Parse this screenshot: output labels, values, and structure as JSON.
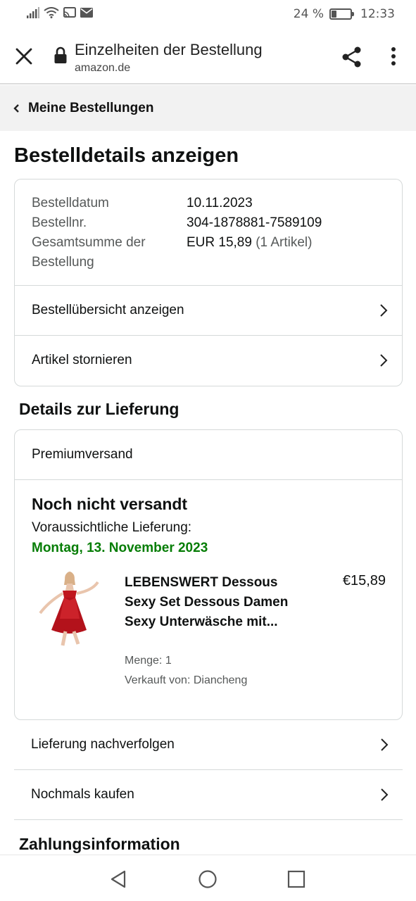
{
  "status_bar": {
    "battery_percent": "24 %",
    "battery_level": 0.24,
    "time": "12:33"
  },
  "browser": {
    "title": "Einzelheiten der Bestellung",
    "domain": "amazon.de",
    "icons": [
      "close-icon",
      "lock-icon",
      "share-icon",
      "more-vert-icon"
    ]
  },
  "breadcrumb": {
    "label": "Meine Bestellungen"
  },
  "page": {
    "title": "Bestelldetails anzeigen"
  },
  "order_summary": {
    "date_label": "Bestelldatum",
    "date_value": "10.11.2023",
    "number_label": "Bestellnr.",
    "number_value": "304-1878881-7589109",
    "total_label": "Gesamtsumme der Bestellung",
    "total_value": "EUR 15,89",
    "total_items": "(1 Artikel)",
    "links": [
      {
        "label": "Bestellübersicht anzeigen"
      },
      {
        "label": "Artikel stornieren"
      }
    ]
  },
  "delivery": {
    "section_title": "Details zur Lieferung",
    "shipping_type": "Premiumversand",
    "status": "Noch nicht versandt",
    "eta_label": "Voraussichtliche Lieferung:",
    "eta_date": "Montag, 13. November 2023",
    "eta_color": "#067d06",
    "product": {
      "title": "LEBENSWERT Dessous Sexy Set Dessous Damen Sexy Unterwäsche mit...",
      "price": "€15,89",
      "quantity": "Menge: 1",
      "seller": "Verkauft von: Diancheng"
    }
  },
  "delivery_links": [
    {
      "label": "Lieferung nachverfolgen"
    },
    {
      "label": "Nochmals kaufen"
    }
  ],
  "payment": {
    "section_title": "Zahlungsinformation"
  },
  "nav_bar": {
    "icons": [
      "back-icon",
      "home-icon",
      "recents-icon"
    ]
  }
}
